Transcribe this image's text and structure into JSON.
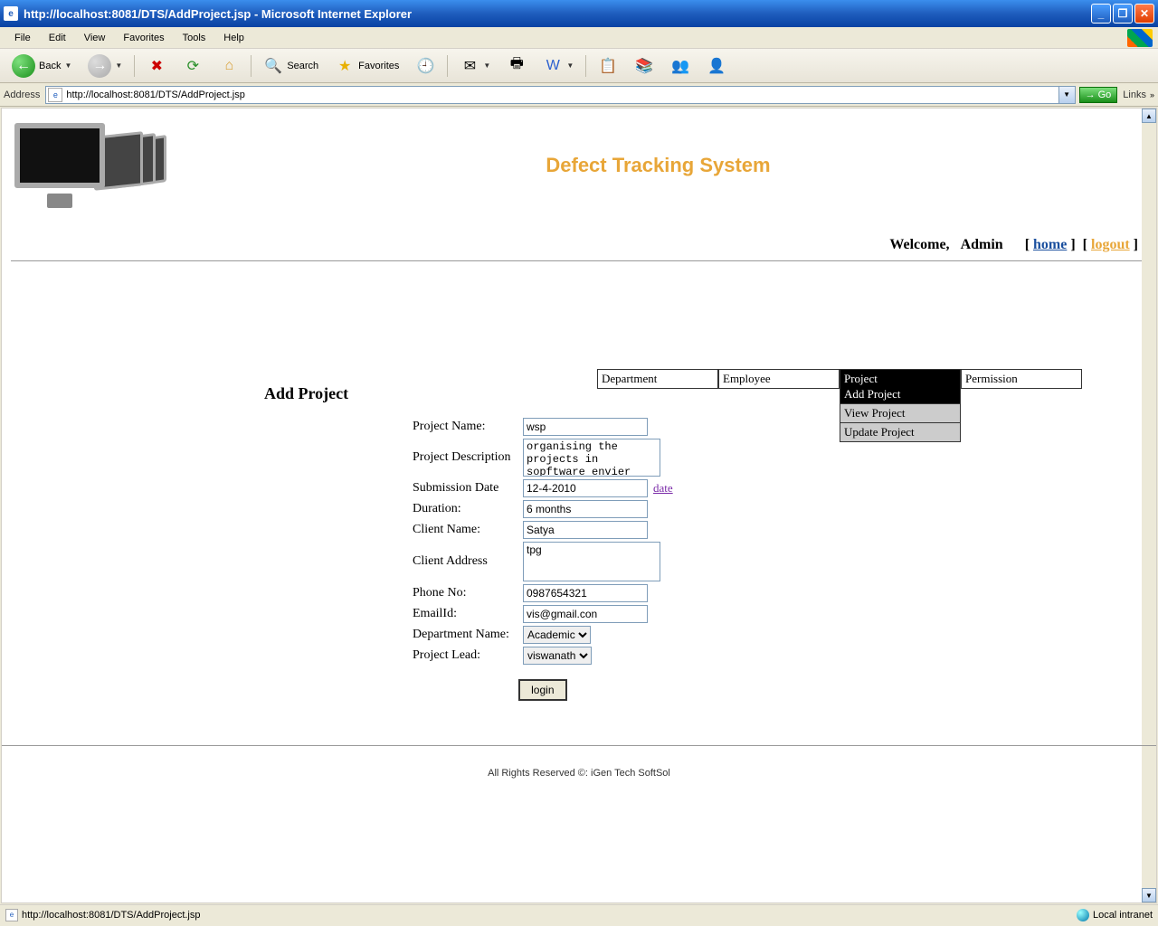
{
  "window": {
    "title": "http://localhost:8081/DTS/AddProject.jsp - Microsoft Internet Explorer"
  },
  "menubar": [
    "File",
    "Edit",
    "View",
    "Favorites",
    "Tools",
    "Help"
  ],
  "toolbar": {
    "back": "Back",
    "search": "Search",
    "favorites": "Favorites"
  },
  "addressbar": {
    "label": "Address",
    "url": "http://localhost:8081/DTS/AddProject.jsp",
    "go": "Go",
    "links": "Links"
  },
  "page": {
    "title": "Defect Tracking System",
    "welcome": "Welcome,",
    "user": "Admin",
    "home": "home",
    "logout": "logout",
    "form_title": "Add Project",
    "nav": [
      "Department",
      "Employee",
      "Project",
      "Permission"
    ],
    "submenu": [
      "Add Project",
      "View Project",
      "Update Project"
    ],
    "form": {
      "project_name_label": "Project Name:",
      "project_name": "wsp",
      "project_desc_label": "Project Description",
      "project_desc": "organising the projects in sopftware envier",
      "submission_date_label": "Submission Date",
      "submission_date": "12-4-2010",
      "date_link": "date",
      "duration_label": "Duration:",
      "duration": "6 months",
      "client_name_label": "Client Name:",
      "client_name": "Satya",
      "client_address_label": "Client Address",
      "client_address": "tpg",
      "phone_label": "Phone No:",
      "phone": "0987654321",
      "email_label": "EmailId:",
      "email": "vis@gmail.con",
      "dept_label": "Department Name:",
      "dept": "Academic",
      "lead_label": "Project Lead:",
      "lead": "viswanath",
      "submit": "login"
    },
    "footer": "All Rights Reserved ©: iGen Tech SoftSol"
  },
  "statusbar": {
    "url": "http://localhost:8081/DTS/AddProject.jsp",
    "zone": "Local intranet"
  }
}
